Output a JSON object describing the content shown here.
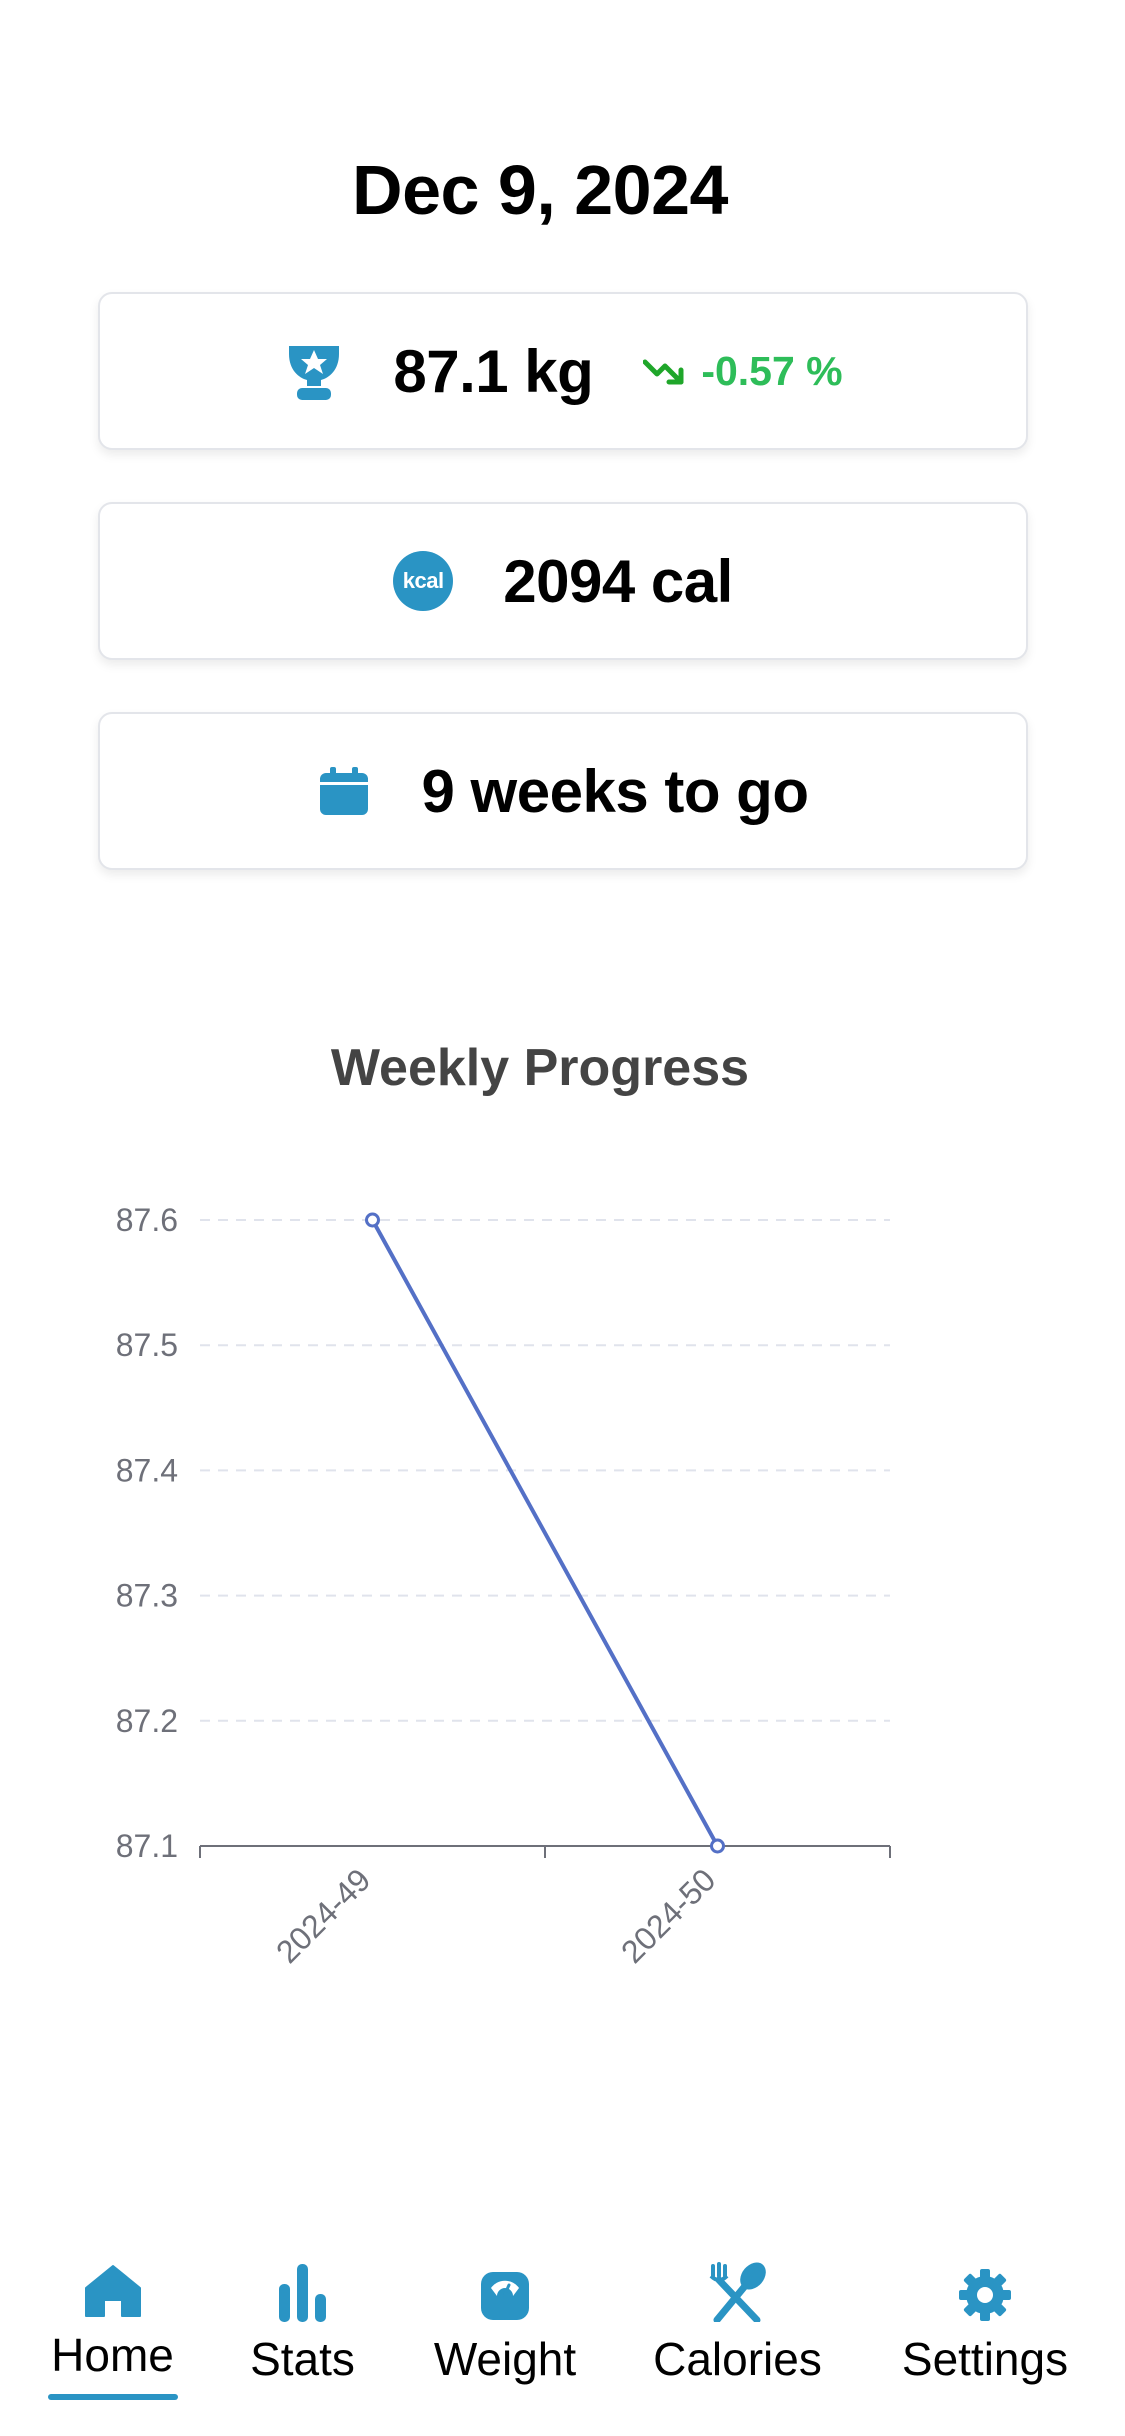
{
  "date": "Dec 9, 2024",
  "cards": {
    "weight": {
      "icon": "trophy-icon",
      "value": "87.1 kg",
      "trend_icon": "trend-down-icon",
      "trend": "-0.57 %"
    },
    "calories": {
      "icon": "kcal-icon",
      "badge": "kcal",
      "value": "2094 cal"
    },
    "weeks": {
      "icon": "calendar-icon",
      "value": "9 weeks to go"
    }
  },
  "colors": {
    "accent": "#2a94c4",
    "trend_positive": "#2ebd59",
    "chart_line": "#5470c6"
  },
  "chart_data": {
    "type": "line",
    "title": "Weekly Progress",
    "x": [
      "2024-49",
      "2024-50"
    ],
    "series": [
      {
        "values": [
          87.6,
          87.1
        ]
      }
    ],
    "xlabel": "",
    "ylabel": "",
    "ylim": [
      87.1,
      87.6
    ],
    "yticks": [
      "87.6",
      "87.5",
      "87.4",
      "87.3",
      "87.2",
      "87.1"
    ],
    "grid": true
  },
  "tabs": [
    {
      "label": "Home",
      "icon": "home-icon",
      "active": true
    },
    {
      "label": "Stats",
      "icon": "bar-chart-icon",
      "active": false
    },
    {
      "label": "Weight",
      "icon": "scale-icon",
      "active": false
    },
    {
      "label": "Calories",
      "icon": "utensils-icon",
      "active": false
    },
    {
      "label": "Settings",
      "icon": "gear-icon",
      "active": false
    }
  ]
}
